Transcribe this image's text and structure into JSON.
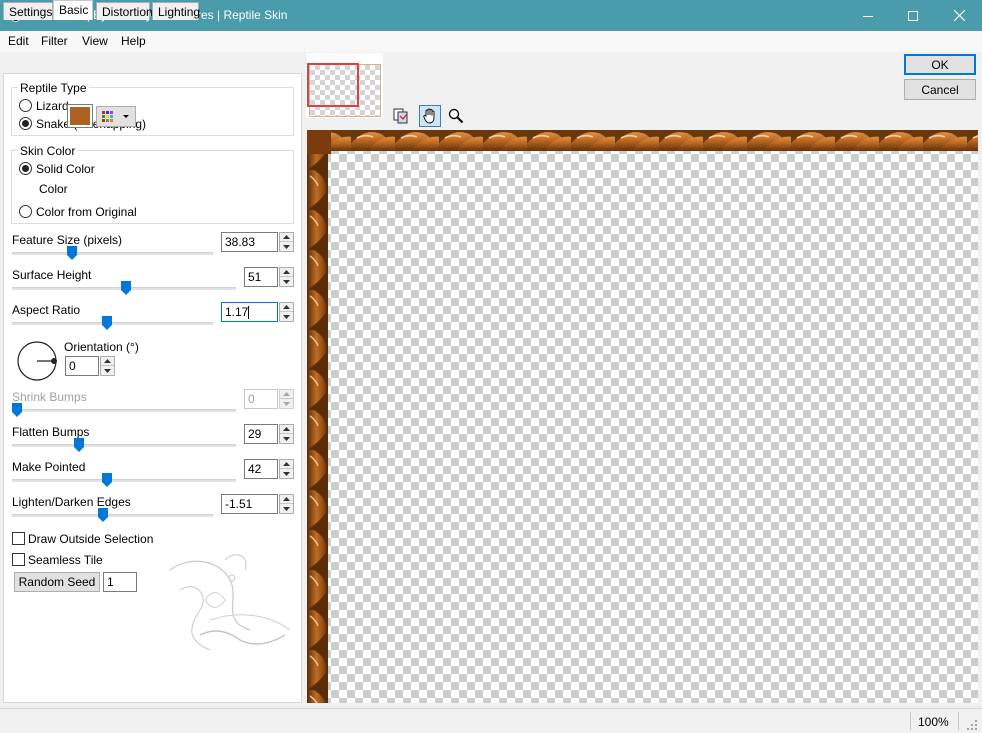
{
  "window": {
    "title": "Alien Skin | Eye Candy 5: Textures | Reptile Skin"
  },
  "menu": [
    "Edit",
    "Filter",
    "View",
    "Help"
  ],
  "tabs": [
    "Settings",
    "Basic",
    "Distortion",
    "Lighting"
  ],
  "reptile_type": {
    "title": "Reptile Type",
    "options": [
      "Lizard",
      "Snake (Overlapping)"
    ],
    "selected": "Snake (Overlapping)"
  },
  "skin_color": {
    "title": "Skin Color",
    "solid": "Solid Color",
    "color_label": "Color",
    "from_original": "Color from Original",
    "color_value": "#ad6222"
  },
  "params": {
    "feature_size": {
      "label": "Feature Size (pixels)",
      "value": "38.83",
      "fraction": 0.29
    },
    "surface_height": {
      "label": "Surface Height",
      "value": "51",
      "fraction": 0.51
    },
    "aspect_ratio": {
      "label": "Aspect Ratio",
      "value": "1.17",
      "fraction": 0.47
    },
    "orientation": {
      "label": "Orientation (°)",
      "value": "0"
    },
    "shrink_bumps": {
      "label": "Shrink Bumps",
      "value": "0",
      "fraction": 0.0
    },
    "flatten_bumps": {
      "label": "Flatten Bumps",
      "value": "29",
      "fraction": 0.29
    },
    "make_pointed": {
      "label": "Make Pointed",
      "value": "42",
      "fraction": 0.42
    },
    "edges": {
      "label": "Lighten/Darken Edges",
      "value": "-1.51",
      "fraction": 0.45
    }
  },
  "checks": {
    "draw_outside": "Draw Outside Selection",
    "seamless": "Seamless Tile"
  },
  "random_seed": {
    "label": "Random Seed",
    "value": "1"
  },
  "buttons": {
    "ok": "OK",
    "cancel": "Cancel"
  },
  "status": {
    "zoom": "100%"
  },
  "colors": {
    "titlebar": "#4a9bab",
    "accent": "#0078d7",
    "reptile": "#ad6222"
  }
}
